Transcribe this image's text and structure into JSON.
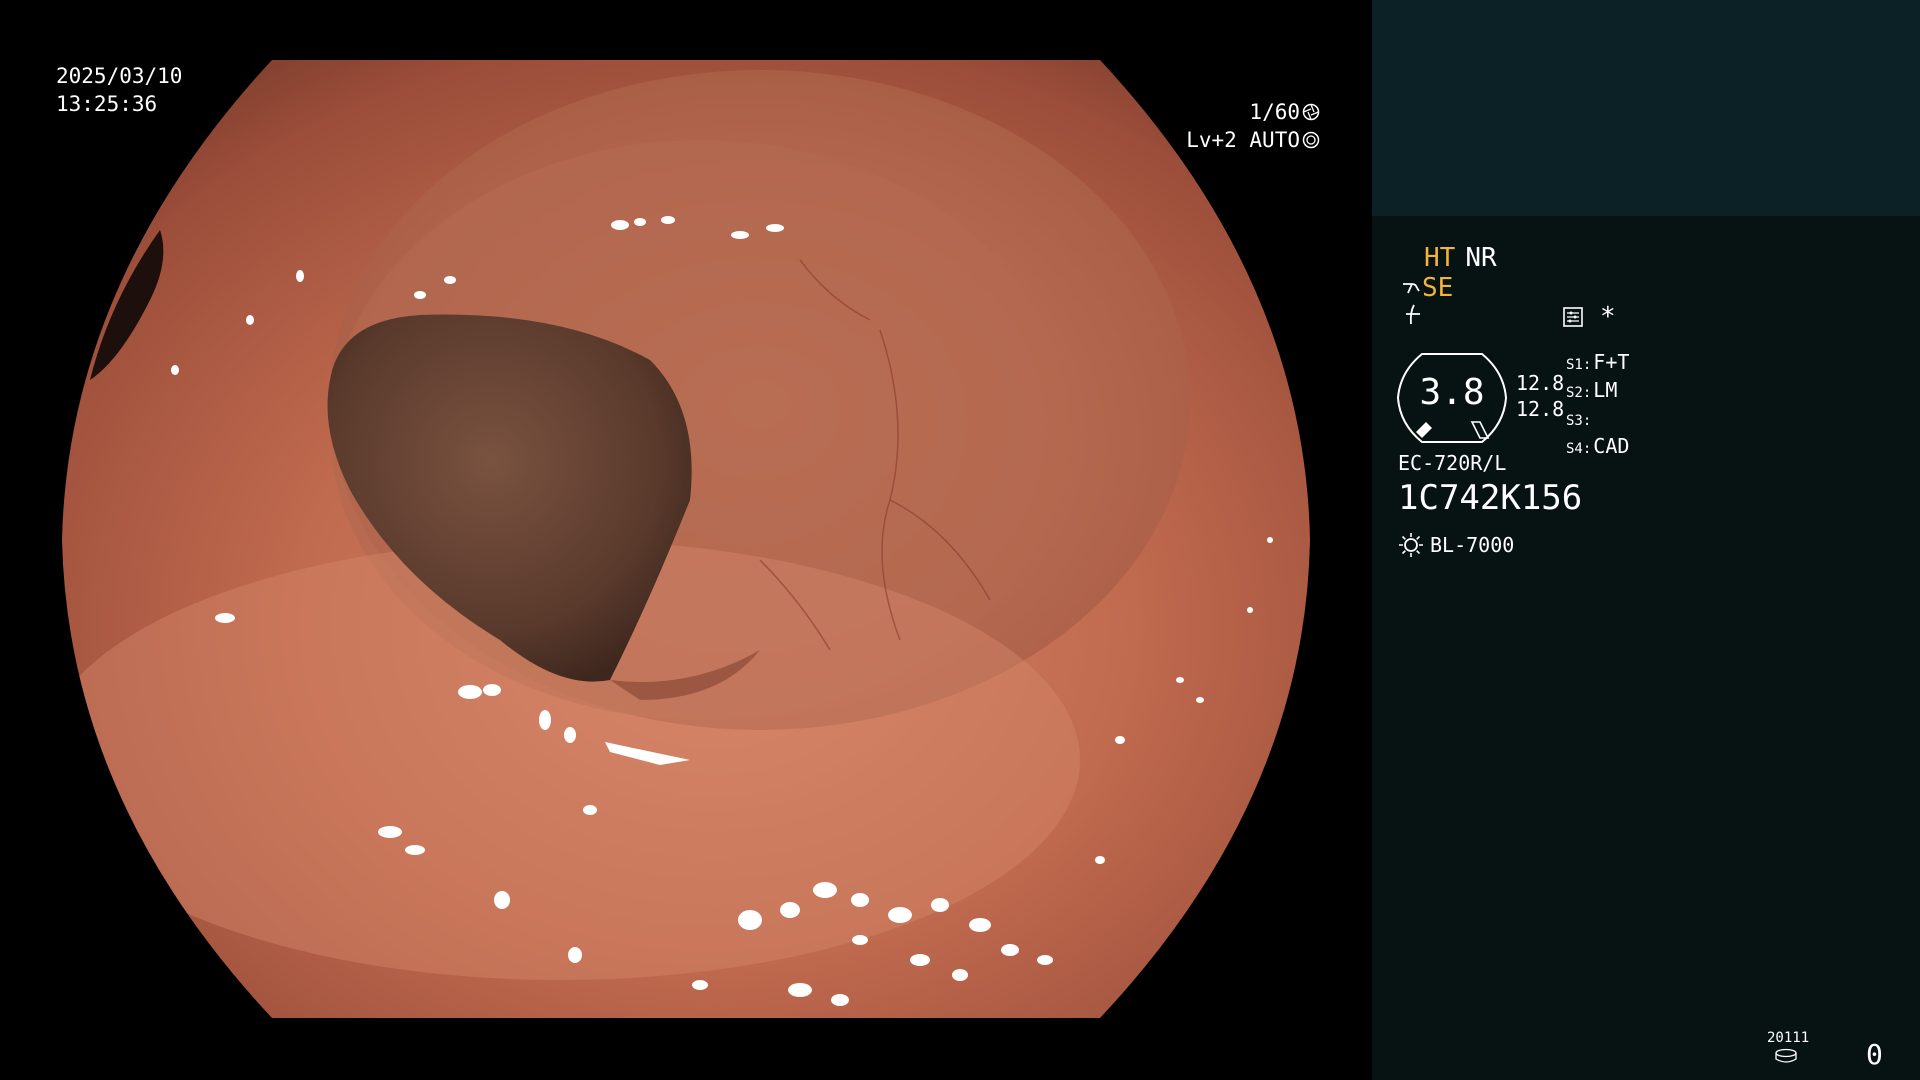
{
  "overlay": {
    "date": "2025/03/10",
    "time": "13:25:36",
    "shutter": "1/60",
    "shutter_icon": "shutter-icon",
    "level": "Lv+2 AUTO",
    "auto_icon": "auto-iris-icon"
  },
  "panel": {
    "ht": "HT",
    "nr": "NR",
    "se": "SE",
    "se_icon": "hook-icon",
    "freeze_icon": "freeze-icon",
    "record_icon": "record-icon",
    "asterisk": "*",
    "gauge_value": "3.8",
    "gauge_sub_1": "12.8",
    "gauge_sub_2": "12.8",
    "s_items": [
      {
        "key": "S1:",
        "value": "F+T"
      },
      {
        "key": "S2:",
        "value": "LM"
      },
      {
        "key": "S3:",
        "value": ""
      },
      {
        "key": "S4:",
        "value": "CAD"
      }
    ],
    "scope_model": "EC-720R/L",
    "scope_serial": "1C742K156",
    "light_icon": "sun-icon",
    "light_source": "BL-7000",
    "counter_small": "20111",
    "counter_icon": "disk-icon",
    "counter_big": "0"
  },
  "colors": {
    "panel_bg": "#071212",
    "panel_top_bg": "#0b2126",
    "accent_yellow": "#f3b33d",
    "mucosa": "#b8644c"
  }
}
